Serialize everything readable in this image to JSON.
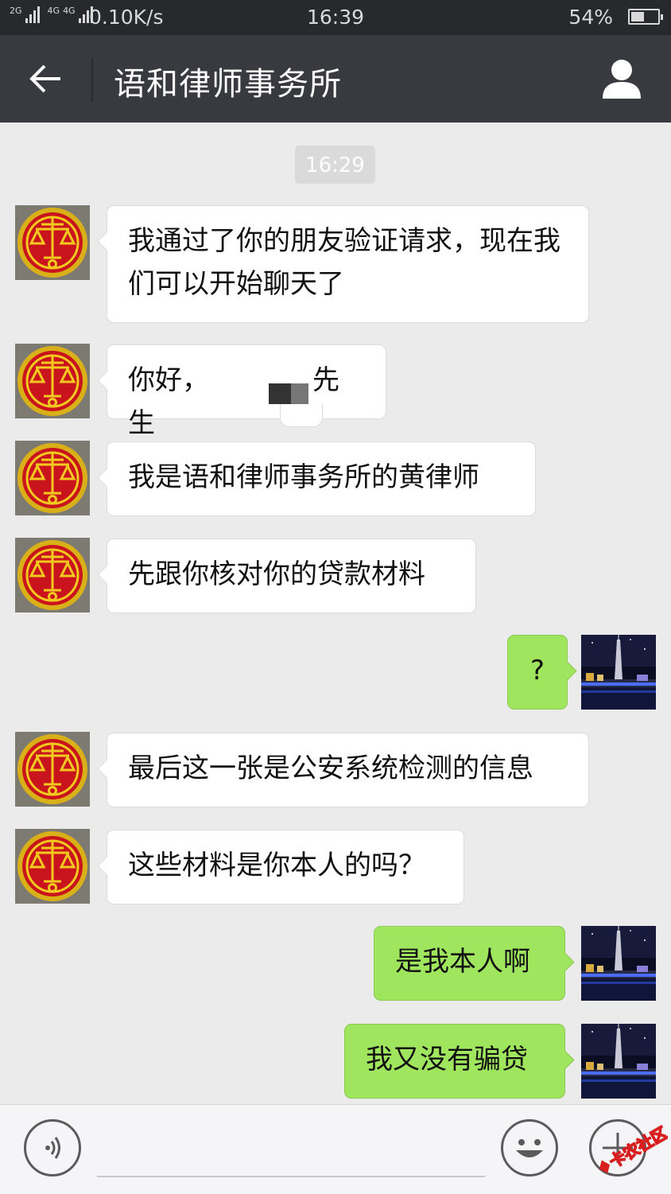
{
  "status_bar": {
    "network_1": "2G",
    "network_2": "4G",
    "network_3": "4G",
    "speed": "0.10K/s",
    "time": "16:39",
    "battery": "54%",
    "battery_level": 0.54
  },
  "header": {
    "title": "语和律师事务所",
    "back_icon": "arrow-left-icon",
    "profile_icon": "person-icon"
  },
  "chat": {
    "timestamp": "16:29",
    "messages": [
      {
        "from": "contact",
        "text": "我通过了你的朋友验证请求，现在我们可以开始聊天了"
      },
      {
        "from": "contact",
        "text": "你好，",
        "text_suffix": "先生",
        "redacted": true
      },
      {
        "from": "contact",
        "text": "我是语和律师事务所的黄律师"
      },
      {
        "from": "contact",
        "text": "先跟你核对你的贷款材料"
      },
      {
        "from": "me",
        "text": "?"
      },
      {
        "from": "contact",
        "text": "最后这一张是公安系统检测的信息"
      },
      {
        "from": "contact",
        "text": "这些材料是你本人的吗？"
      },
      {
        "from": "me",
        "text": "是我本人啊"
      },
      {
        "from": "me",
        "text": "我又没有骗贷"
      }
    ]
  },
  "bottom_bar": {
    "voice_icon": "voice-icon",
    "emoji_icon": "emoji-icon",
    "plus_icon": "plus-icon"
  },
  "watermark": {
    "text": "卡农社区"
  },
  "colors": {
    "header_bg": "#393a3f",
    "status_bg": "#27292d",
    "chat_bg": "#ebebeb",
    "outgoing_bubble": "#9fe55e",
    "incoming_bubble": "#ffffff"
  }
}
